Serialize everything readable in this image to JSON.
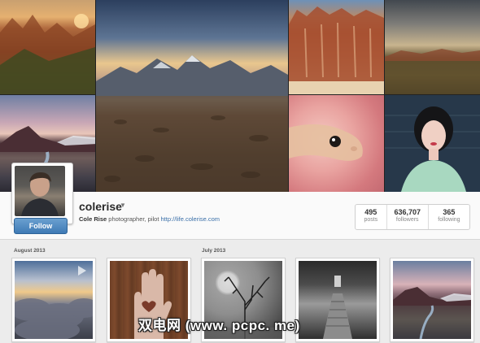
{
  "profile": {
    "username": "colerise",
    "full_name": "Cole Rise",
    "bio_text": "photographer, pilot",
    "website": "http://life.colerise.com",
    "follow_label": "Follow"
  },
  "stats": [
    {
      "value": "495",
      "label": "posts"
    },
    {
      "value": "636,707",
      "label": "followers"
    },
    {
      "value": "365",
      "label": "following"
    }
  ],
  "feed": {
    "months": [
      "August 2013",
      "July 2013"
    ]
  },
  "watermark": "双电网 (www. pcpc. me)",
  "colors": {
    "follow_button": "#3f7ab5",
    "link": "#3a6fa8",
    "page_background": "#ececec"
  }
}
